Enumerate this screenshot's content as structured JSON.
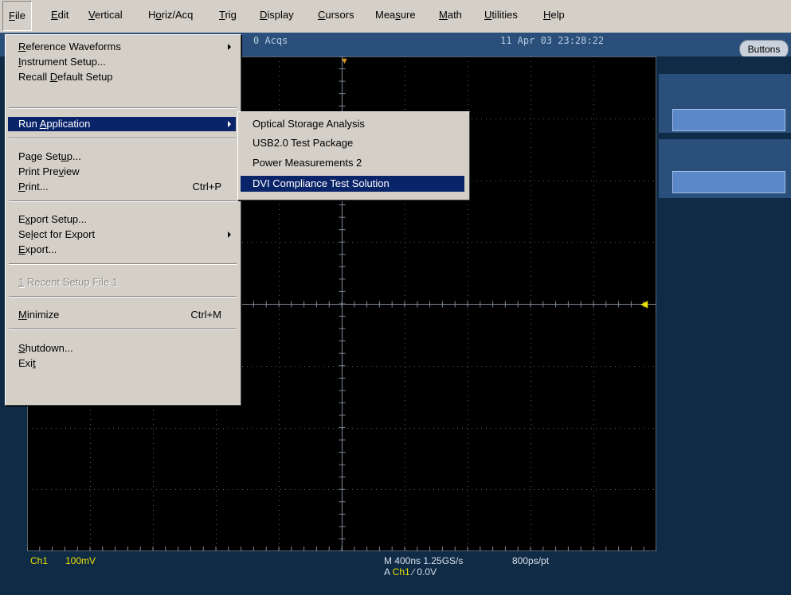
{
  "menubar": {
    "items": [
      {
        "label": "File",
        "mn": "F",
        "rest": "ile"
      },
      {
        "label": "Edit",
        "mn": "E",
        "rest": "dit"
      },
      {
        "label": "Vertical",
        "mn": "V",
        "rest": "ertical"
      },
      {
        "pre": "H",
        "mn": "o",
        "rest": "riz/Acq"
      },
      {
        "mn": "T",
        "rest": "rig"
      },
      {
        "mn": "D",
        "rest": "isplay"
      },
      {
        "mn": "C",
        "rest": "ursors"
      },
      {
        "pre": "Mea",
        "mn": "s",
        "rest": "ure"
      },
      {
        "mn": "M",
        "rest": "ath"
      },
      {
        "mn": "U",
        "rest": "tilities"
      },
      {
        "mn": "H",
        "rest": "elp"
      }
    ]
  },
  "scope": {
    "acqs": "0 Acqs",
    "datetime": "11 Apr 03 23:28:22",
    "buttons_label": "Buttons",
    "ch1_label": "Ch1",
    "ch1_scale": "100mV",
    "horiz_line": "M 400ns 1.25GS/s",
    "resolution": "800ps/pt",
    "trig_prefix": "A",
    "trig_source": "Ch1",
    "trig_slope": "∕",
    "trig_level": "0.0V"
  },
  "file_menu": {
    "items": [
      {
        "pre": "",
        "mn": "R",
        "rest": "eference Waveforms",
        "submenu": true
      },
      {
        "pre": "",
        "mn": "I",
        "rest": "nstrument Setup..."
      },
      {
        "pre": "Recall ",
        "mn": "D",
        "rest": "efault Setup"
      },
      {
        "pre": "Run ",
        "mn": "A",
        "rest": "pplication",
        "submenu": true,
        "highlighted": true
      },
      {
        "pre": "Page Set",
        "mn": "u",
        "rest": "p..."
      },
      {
        "pre": "Print Pre",
        "mn": "v",
        "rest": "iew"
      },
      {
        "pre": "",
        "mn": "P",
        "rest": "rint...",
        "shortcut": "Ctrl+P"
      },
      {
        "pre": "E",
        "mn": "x",
        "rest": "port Setup..."
      },
      {
        "pre": "Se",
        "mn": "l",
        "rest": "ect for Export",
        "submenu": true
      },
      {
        "pre": "",
        "mn": "E",
        "rest": "xport..."
      },
      {
        "pre": "",
        "mn": "1",
        "rest": " Recent Setup File 1",
        "disabled": true
      },
      {
        "pre": "",
        "mn": "M",
        "rest": "inimize",
        "shortcut": "Ctrl+M"
      },
      {
        "pre": "",
        "mn": "S",
        "rest": "hutdown..."
      },
      {
        "pre": "Exi",
        "mn": "t",
        "rest": ""
      }
    ]
  },
  "run_application_menu": {
    "items": [
      {
        "label": "Optical Storage Analysis"
      },
      {
        "label": "USB2.0 Test Package"
      },
      {
        "label": "Power Measurements 2"
      },
      {
        "label": "DVI Compliance Test Solution",
        "highlighted": true
      }
    ]
  },
  "colors": {
    "menu_bg": "#d4d0c8",
    "highlight": "#0a246a",
    "graticule_bg": "#000000",
    "grid_dots": "#5a6470",
    "trace_yellow": "#e8e000",
    "panel_blue": "#2a4f7a"
  },
  "icons": [
    "submenu-arrow-icon",
    "trigger-position-icon",
    "ch1-ground-marker-icon"
  ]
}
